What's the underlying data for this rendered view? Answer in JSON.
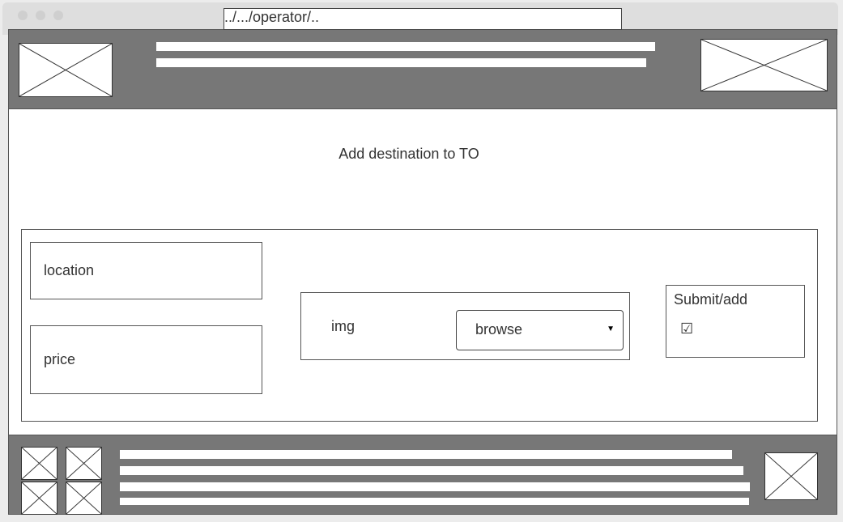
{
  "browser": {
    "url": "../.../operator/.."
  },
  "header": {
    "logo_left": "image-placeholder",
    "logo_right": "image-placeholder"
  },
  "main": {
    "title": "Add destination to TO",
    "form": {
      "location_label": "location",
      "price_label": "price",
      "img_label": "img",
      "browse_select_value": "browse",
      "submit_label": "Submit/add",
      "submit_checkbox": "☑"
    }
  },
  "footer": {
    "thumbnails": [
      "image-placeholder",
      "image-placeholder",
      "image-placeholder",
      "image-placeholder"
    ],
    "right_image": "image-placeholder"
  }
}
